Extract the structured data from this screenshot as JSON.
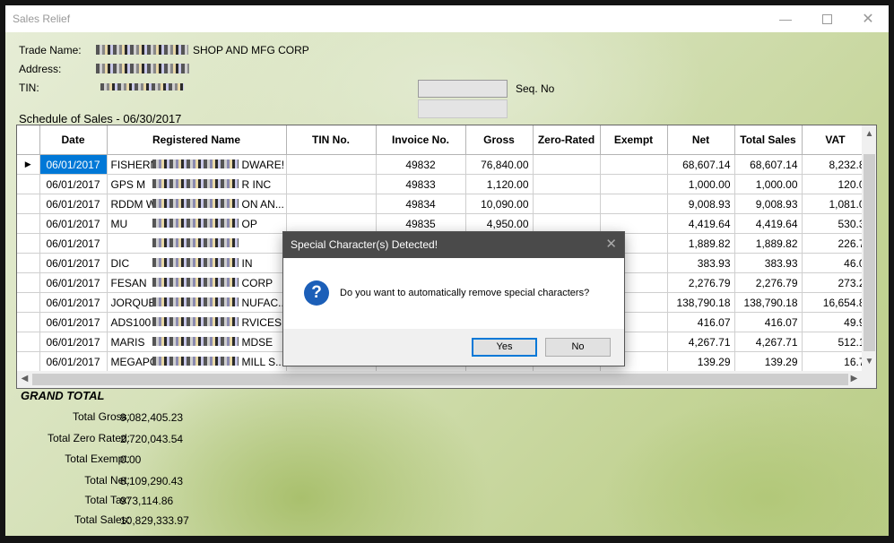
{
  "window": {
    "title": "Sales Relief"
  },
  "header": {
    "trade_name_label": "Trade Name:",
    "trade_name_value": "SHOP AND MFG CORP",
    "address_label": "Address:",
    "tin_label": "TIN:",
    "seq_label": "Seq. No",
    "schedule_title": "Schedule of Sales - 06/30/2017"
  },
  "table": {
    "columns": [
      "Date",
      "Registered Name",
      "TIN No.",
      "Invoice No.",
      "Gross",
      "Zero-Rated",
      "Exempt",
      "Net",
      "Total Sales",
      "VAT"
    ],
    "rows": [
      {
        "date": "06/01/2017",
        "name_pre": "FISHERM",
        "name_post": "DWARE!",
        "invoice": "49832",
        "gross": "76,840.00",
        "net": "68,607.14",
        "total_sales": "68,607.14",
        "vat": "8,232.8"
      },
      {
        "date": "06/01/2017",
        "name_pre": "GPS M",
        "name_post": "R INC",
        "invoice": "49833",
        "gross": "1,120.00",
        "net": "1,000.00",
        "total_sales": "1,000.00",
        "vat": "120.0"
      },
      {
        "date": "06/01/2017",
        "name_pre": "RDDM W",
        "name_post": "ON AN...",
        "invoice": "49834",
        "gross": "10,090.00",
        "net": "9,008.93",
        "total_sales": "9,008.93",
        "vat": "1,081.0"
      },
      {
        "date": "06/01/2017",
        "name_pre": "MU",
        "name_post": "OP",
        "invoice": "49835",
        "gross": "4,950.00",
        "net": "4,419.64",
        "total_sales": "4,419.64",
        "vat": "530.3"
      },
      {
        "date": "06/01/2017",
        "name_pre": "",
        "name_post": "",
        "invoice": "",
        "gross": "",
        "net": "1,889.82",
        "total_sales": "1,889.82",
        "vat": "226.7"
      },
      {
        "date": "06/01/2017",
        "name_pre": "DIC",
        "name_post": "IN",
        "invoice": "",
        "gross": "",
        "net": "383.93",
        "total_sales": "383.93",
        "vat": "46.0"
      },
      {
        "date": "06/01/2017",
        "name_pre": "FESAN",
        "name_post": "CORP",
        "invoice": "",
        "gross": "",
        "net": "2,276.79",
        "total_sales": "2,276.79",
        "vat": "273.2"
      },
      {
        "date": "06/01/2017",
        "name_pre": "JORQUE",
        "name_post": "NUFAC...",
        "invoice": "",
        "gross": "",
        "net": "138,790.18",
        "total_sales": "138,790.18",
        "vat": "16,654.8"
      },
      {
        "date": "06/01/2017",
        "name_pre": "ADS100",
        "name_post": "RVICES",
        "invoice": "",
        "gross": "",
        "net": "416.07",
        "total_sales": "416.07",
        "vat": "49.9"
      },
      {
        "date": "06/01/2017",
        "name_pre": "MARIS",
        "name_post": "MDSE",
        "invoice": "",
        "gross": "",
        "net": "4,267.71",
        "total_sales": "4,267.71",
        "vat": "512.1"
      },
      {
        "date": "06/01/2017",
        "name_pre": "MEGAPO",
        "name_post": "MILL S...",
        "invoice": "",
        "gross": "",
        "net": "139.29",
        "total_sales": "139.29",
        "vat": "16.7"
      }
    ]
  },
  "totals": {
    "title": "GRAND TOTAL",
    "items": [
      {
        "label": "Total Gross:",
        "value": "9,082,405.23"
      },
      {
        "label": "Total Zero Rated:",
        "value": "2,720,043.54"
      },
      {
        "label": "Total Exempt:",
        "value": "0.00"
      },
      {
        "label": "Total Net:",
        "value": "8,109,290.43"
      },
      {
        "label": "Total Tax:",
        "value": "973,114.86"
      },
      {
        "label": "Total Sales:",
        "value": "10,829,333.97"
      }
    ]
  },
  "dialog": {
    "title": "Special Character(s) Detected!",
    "message": "Do you want to automatically remove special characters?",
    "yes_label": "Yes",
    "no_label": "No",
    "icon": "question-icon"
  }
}
